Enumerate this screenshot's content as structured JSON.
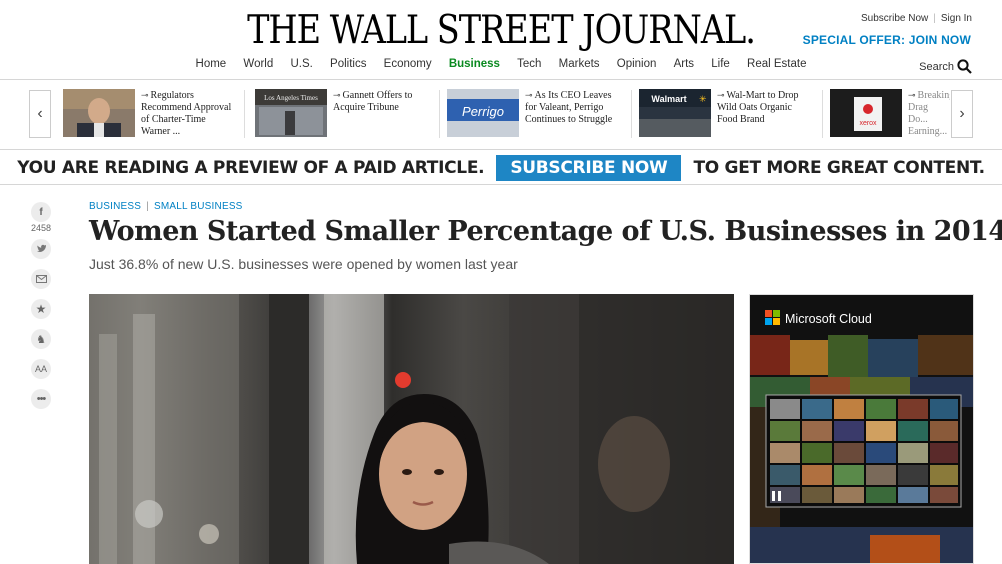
{
  "header": {
    "logo": "THE WALL STREET JOURNAL.",
    "subscribe_link": "Subscribe Now",
    "signin_link": "Sign In",
    "special_offer": "SPECIAL OFFER: JOIN NOW",
    "search_label": "Search",
    "nav": [
      {
        "label": "Home"
      },
      {
        "label": "World"
      },
      {
        "label": "U.S."
      },
      {
        "label": "Politics"
      },
      {
        "label": "Economy"
      },
      {
        "label": "Business"
      },
      {
        "label": "Tech"
      },
      {
        "label": "Markets"
      },
      {
        "label": "Opinion"
      },
      {
        "label": "Arts"
      },
      {
        "label": "Life"
      },
      {
        "label": "Real Estate"
      }
    ]
  },
  "carousel": {
    "items": [
      {
        "title": "Regulators Recommend Approval of Charter-Time Warner ...",
        "thumb_caption": ""
      },
      {
        "title": "Gannett Offers to Acquire Tribune",
        "thumb_caption": "Los Angeles Times"
      },
      {
        "title": "As Its CEO Leaves for Valeant, Perrigo Continues to Struggle",
        "thumb_caption": "Perrigo"
      },
      {
        "title": "Wal-Mart to Drop Wild Oats Organic Food Brand",
        "thumb_caption": "Walmart"
      },
      {
        "title": "Breaking Drag Do... Earning...",
        "thumb_caption": "xerox"
      }
    ]
  },
  "paywall": {
    "before": "YOU ARE READING A PREVIEW OF A PAID ARTICLE.",
    "button": "SUBSCRIBE NOW",
    "after": "TO GET MORE GREAT CONTENT."
  },
  "share": {
    "facebook_count": "2458"
  },
  "article": {
    "section": "BUSINESS",
    "subsection": "SMALL BUSINESS",
    "headline": "Women Started Smaller Percentage of U.S. Businesses in 2014",
    "dek": "Just 36.8% of new U.S. businesses were opened by women last year"
  },
  "ad": {
    "brand": "Microsoft Cloud"
  },
  "colors": {
    "accent_blue": "#0080c3",
    "business_green": "#0a8a20",
    "subscribe_button": "#1e86c5"
  }
}
